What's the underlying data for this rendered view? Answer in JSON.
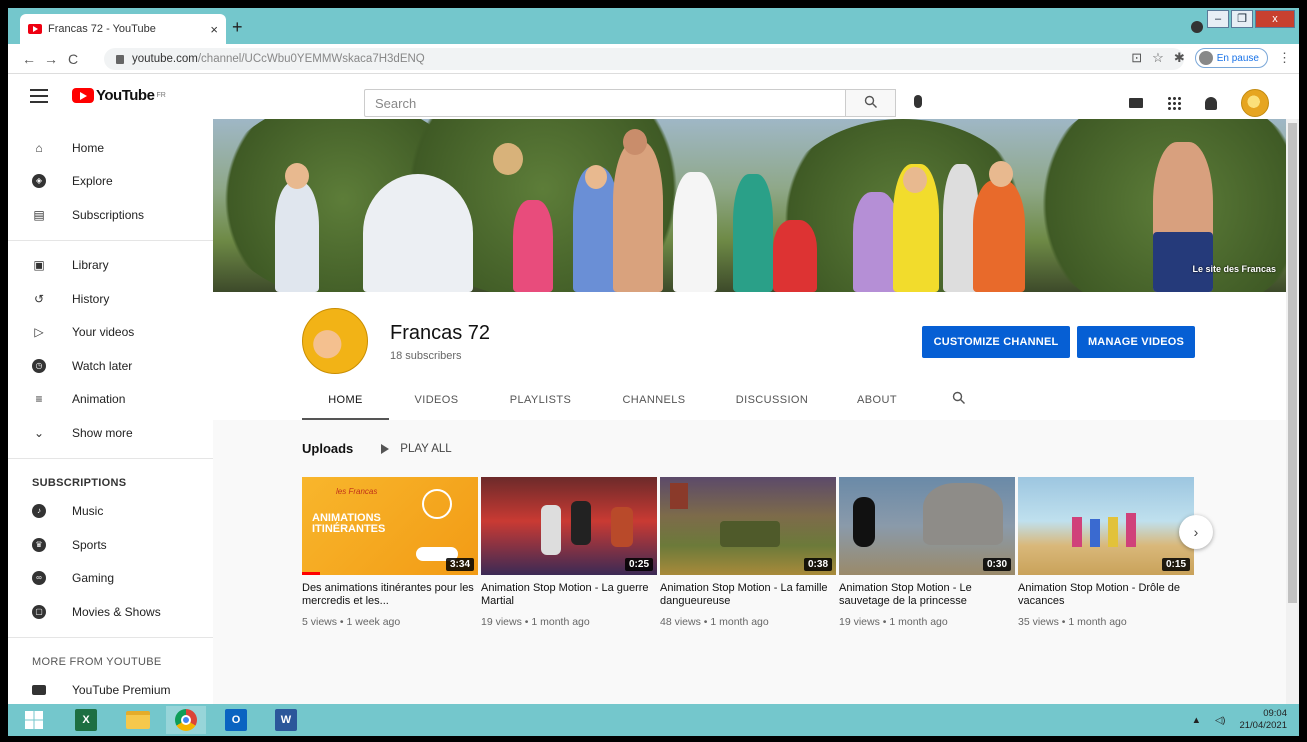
{
  "browser": {
    "tab_title": "Francas 72 - YouTube",
    "tab_close": "×",
    "new_tab": "+",
    "url_host": "youtube.com",
    "url_path": "/channel/UCcWbu0YEMMWskaca7H3dENQ",
    "profile_label": "En pause",
    "win_minimize": "–",
    "win_restore": "❐",
    "win_close": "x"
  },
  "yt": {
    "logo_word": "YouTube",
    "region": "FR",
    "search_placeholder": "Search"
  },
  "sidebar": {
    "main": [
      {
        "label": "Home",
        "icon": "home-icon"
      },
      {
        "label": "Explore",
        "icon": "compass-icon"
      },
      {
        "label": "Subscriptions",
        "icon": "subscriptions-icon"
      }
    ],
    "library": [
      {
        "label": "Library",
        "icon": "library-icon"
      },
      {
        "label": "History",
        "icon": "history-icon"
      },
      {
        "label": "Your videos",
        "icon": "your-videos-icon"
      },
      {
        "label": "Watch later",
        "icon": "clock-icon"
      },
      {
        "label": "Animation",
        "icon": "playlist-icon"
      },
      {
        "label": "Show more",
        "icon": "chevron-down-icon"
      }
    ],
    "subscriptions_heading": "SUBSCRIPTIONS",
    "subscriptions": [
      {
        "label": "Music",
        "icon": "music-icon"
      },
      {
        "label": "Sports",
        "icon": "trophy-icon"
      },
      {
        "label": "Gaming",
        "icon": "gamepad-icon"
      },
      {
        "label": "Movies & Shows",
        "icon": "film-icon"
      }
    ],
    "more_heading": "MORE FROM YOUTUBE",
    "more": [
      {
        "label": "YouTube Premium",
        "icon": "youtube-icon"
      }
    ]
  },
  "banner": {
    "watermark_text": "Le site des Francas"
  },
  "channel": {
    "name": "Francas 72",
    "subscribers": "18 subscribers",
    "customize_label": "CUSTOMIZE CHANNEL",
    "manage_label": "MANAGE VIDEOS",
    "tabs": [
      "HOME",
      "VIDEOS",
      "PLAYLISTS",
      "CHANNELS",
      "DISCUSSION",
      "ABOUT"
    ]
  },
  "uploads": {
    "heading": "Uploads",
    "play_all": "PLAY ALL",
    "videos": [
      {
        "title": "Des animations itinérantes pour les mercredis et les...",
        "meta": "5 views • 1 week ago",
        "duration": "3:34",
        "thumb_text": "ANIMATIONS ITINÉRANTES",
        "thumb_brand": "les Francas"
      },
      {
        "title": "Animation Stop Motion - La guerre Martial",
        "meta": "19 views • 1 month ago",
        "duration": "0:25"
      },
      {
        "title": "Animation Stop Motion - La famille dangueureuse",
        "meta": "48 views • 1 month ago",
        "duration": "0:38"
      },
      {
        "title": "Animation Stop Motion - Le sauvetage de la princesse",
        "meta": "19 views • 1 month ago",
        "duration": "0:30"
      },
      {
        "title": "Animation Stop Motion - Drôle de vacances",
        "meta": "35 views • 1 month ago",
        "duration": "0:15"
      }
    ],
    "next_arrow": "›"
  },
  "taskbar": {
    "time": "09:04",
    "date": "21/04/2021",
    "tray_arrow": "▲"
  },
  "colors": {
    "accent_blue": "#065fd4",
    "yt_red": "#ff0000",
    "chrome_teal": "#74c7cc"
  }
}
